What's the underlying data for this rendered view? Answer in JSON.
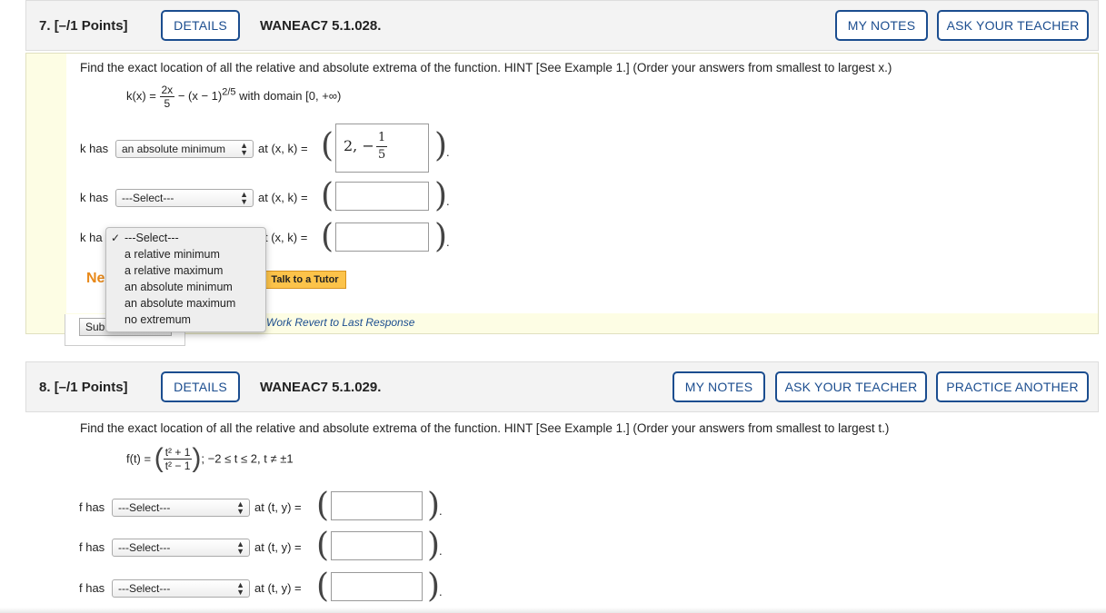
{
  "q7": {
    "number": "7.",
    "points": "[–/1 Points]",
    "details_label": "DETAILS",
    "code": "WANEAC7 5.1.028.",
    "my_notes_label": "MY NOTES",
    "ask_teacher_label": "ASK YOUR TEACHER",
    "prompt": "Find the exact location of all the relative and absolute extrema of the function. HINT [See Example 1.] (Order your answers from smallest to largest x.)",
    "formula": {
      "lhs": "k(x) =",
      "frac_num": "2x",
      "frac_den": "5",
      "rest": "− (x − 1)",
      "exponent": "2/5",
      "domain": "with domain [0, +∞)"
    },
    "rows": [
      {
        "prefix": "k has",
        "select_value": "an absolute minimum",
        "at_label": "at (x, k) =",
        "answer": "2, −",
        "answer_frac_num": "1",
        "answer_frac_den": "5"
      },
      {
        "prefix": "k has",
        "select_value": "---Select---",
        "at_label": "at (x, k) =",
        "answer": ""
      },
      {
        "prefix": "k ha",
        "select_value": "",
        "at_label": "t (x, k) =",
        "answer": ""
      }
    ],
    "need_help": "Ne",
    "talk_tutor_label": "Talk to a Tutor",
    "submit_label": "Sub",
    "revert_label": "Work  Revert to Last Response",
    "dropdown": {
      "checkmark": "✓",
      "options": [
        "---Select---",
        "a relative minimum",
        "a relative maximum",
        "an absolute minimum",
        "an absolute maximum",
        "no extremum"
      ]
    }
  },
  "q8": {
    "number": "8.",
    "points": "[–/1 Points]",
    "details_label": "DETAILS",
    "code": "WANEAC7 5.1.029.",
    "my_notes_label": "MY NOTES",
    "ask_teacher_label": "ASK YOUR TEACHER",
    "practice_label": "PRACTICE ANOTHER",
    "prompt": "Find the exact location of all the relative and absolute extrema of the function. HINT [See Example 1.] (Order your answers from smallest to largest t.)",
    "formula": {
      "lhs": "f(t) =",
      "frac_num": "t² + 1",
      "frac_den": "t² − 1",
      "domain": "; −2 ≤ t ≤ 2, t ≠ ±1"
    },
    "rows": [
      {
        "prefix": "f has",
        "select_value": "---Select---",
        "at_label": "at (t, y) ="
      },
      {
        "prefix": "f has",
        "select_value": "---Select---",
        "at_label": "at (t, y) ="
      },
      {
        "prefix": "f has",
        "select_value": "---Select---",
        "at_label": "at (t, y) ="
      }
    ]
  }
}
